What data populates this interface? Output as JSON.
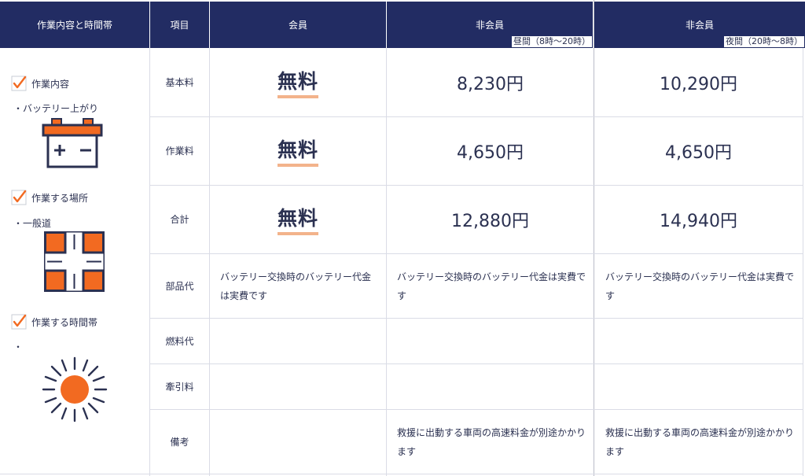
{
  "header": {
    "col1": "作業内容と時間帯",
    "col2": "項目",
    "col3": "会員",
    "col4": "非会員",
    "col4_sub": "昼間（8時〜20時）",
    "col5": "非会員",
    "col5_sub": "夜間（20時〜8時）"
  },
  "sidebar": {
    "work_label": "作業内容",
    "work_value": "・バッテリー上がり",
    "place_label": "作業する場所",
    "place_value": "・一般道",
    "time_label": "作業する時間帯",
    "time_value": "・"
  },
  "rows": {
    "basic": {
      "label": "基本料",
      "member": "無料",
      "day": "8,230円",
      "night": "10,290円"
    },
    "work": {
      "label": "作業料",
      "member": "無料",
      "day": "4,650円",
      "night": "4,650円"
    },
    "total": {
      "label": "合計",
      "member": "無料",
      "day": "12,880円",
      "night": "14,940円"
    },
    "parts": {
      "label": "部品代",
      "member": "バッテリー交換時のバッテリー代金は実費です",
      "day": "バッテリー交換時のバッテリー代金は実費です",
      "night": "バッテリー交換時のバッテリー代金は実費です"
    },
    "fuel": {
      "label": "燃料代"
    },
    "tow": {
      "label": "牽引料"
    },
    "remarks": {
      "label": "備考",
      "day": "救援に出動する車両の高速料金が別途かかります",
      "night": "救援に出動する車両の高速料金が別途かかります"
    }
  },
  "colors": {
    "header_bg": "#222c63",
    "accent_orange": "#f26a21",
    "underline": "#f3b38b",
    "text": "#2b3151"
  },
  "icons": [
    "checkmark-icon",
    "battery-icon",
    "road-intersection-icon",
    "sun-icon"
  ]
}
